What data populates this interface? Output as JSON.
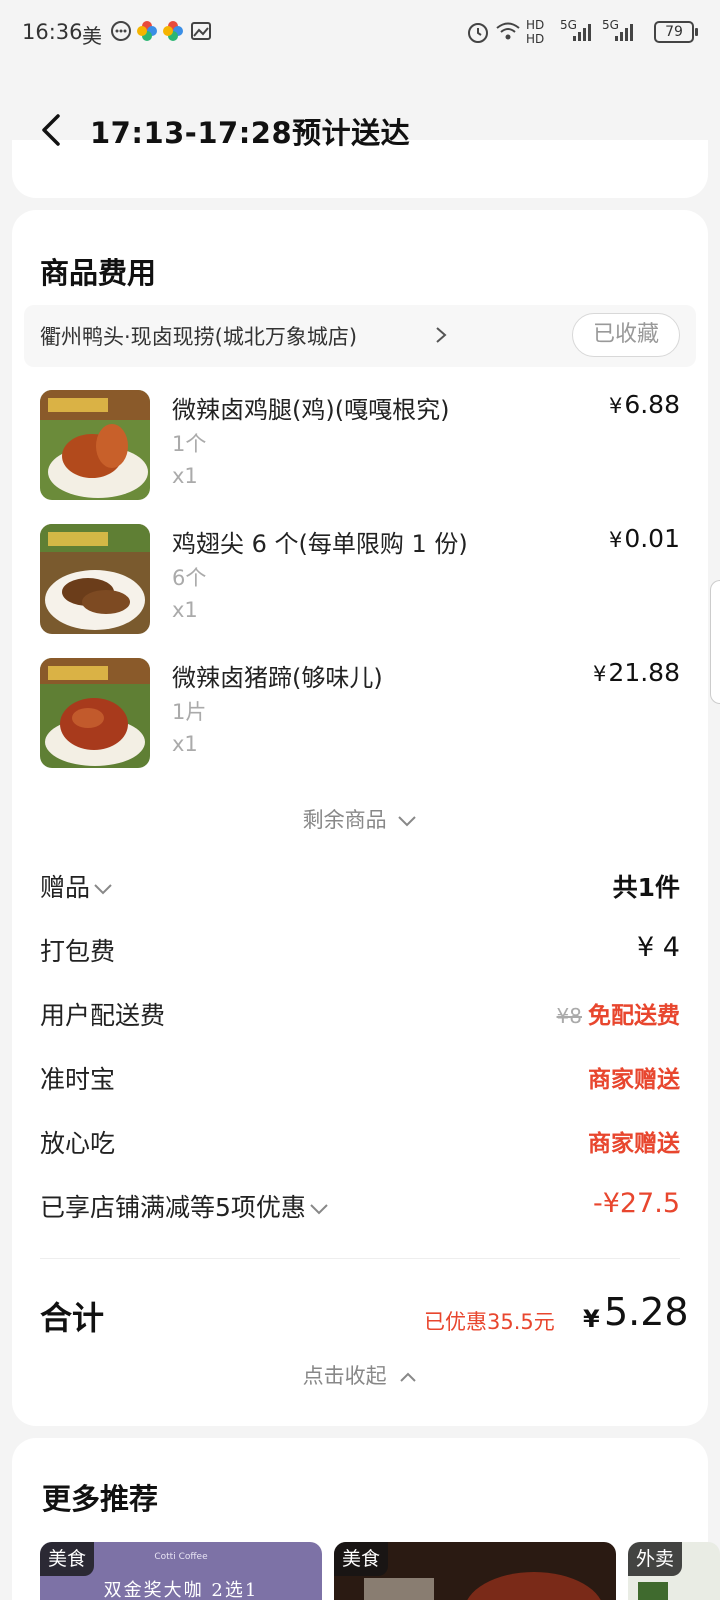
{
  "status_bar": {
    "time": "16:36",
    "app_char": "美",
    "hd_label": "HD",
    "signal1": "5G",
    "signal2": "5G",
    "battery": "79"
  },
  "header": {
    "title": "17:13-17:28预计送达"
  },
  "fees_card": {
    "title": "商品费用",
    "store_name": "衢州鸭头·现卤现捞(城北万象城店)",
    "fav_label": "已收藏",
    "items": [
      {
        "name": "微辣卤鸡腿(鸡)(嘎嘎根究)",
        "spec": "1个",
        "qty": "x1",
        "yen": "¥",
        "price": "6.88"
      },
      {
        "name": "鸡翅尖 6 个(每单限购 1 份)",
        "spec": "6个",
        "qty": "x1",
        "yen": "¥",
        "price": "0.01"
      },
      {
        "name": "微辣卤猪蹄(够味儿)",
        "spec": "1片",
        "qty": "x1",
        "yen": "¥",
        "price": "21.88"
      }
    ],
    "more_goods": "剩余商品",
    "rows": {
      "gift_label": "赠品",
      "gift_value": "共1件",
      "packing_label": "打包费",
      "packing_value": "¥ 4",
      "delivery_label": "用户配送费",
      "delivery_original": "¥8",
      "delivery_value": "免配送费",
      "ontime_label": "准时宝",
      "ontime_value": "商家赠送",
      "safe_label": "放心吃",
      "safe_value": "商家赠送",
      "discount_label": "已享店铺满减等5项优惠",
      "discount_value": "-¥27.5"
    },
    "total_label": "合计",
    "total_discount": "已优惠35.5元",
    "total_yen": "¥",
    "total_value": "5.28",
    "collapse": "点击收起"
  },
  "recommend": {
    "title": "更多推荐",
    "cards": [
      {
        "tag": "美食",
        "text": "双金奖大咖 2选1",
        "brand": "Cotti Coffee"
      },
      {
        "tag": "美食"
      },
      {
        "tag": "外卖"
      }
    ]
  },
  "colors": {
    "accent_red": "#e8462e",
    "background": "#f4f4f4"
  }
}
